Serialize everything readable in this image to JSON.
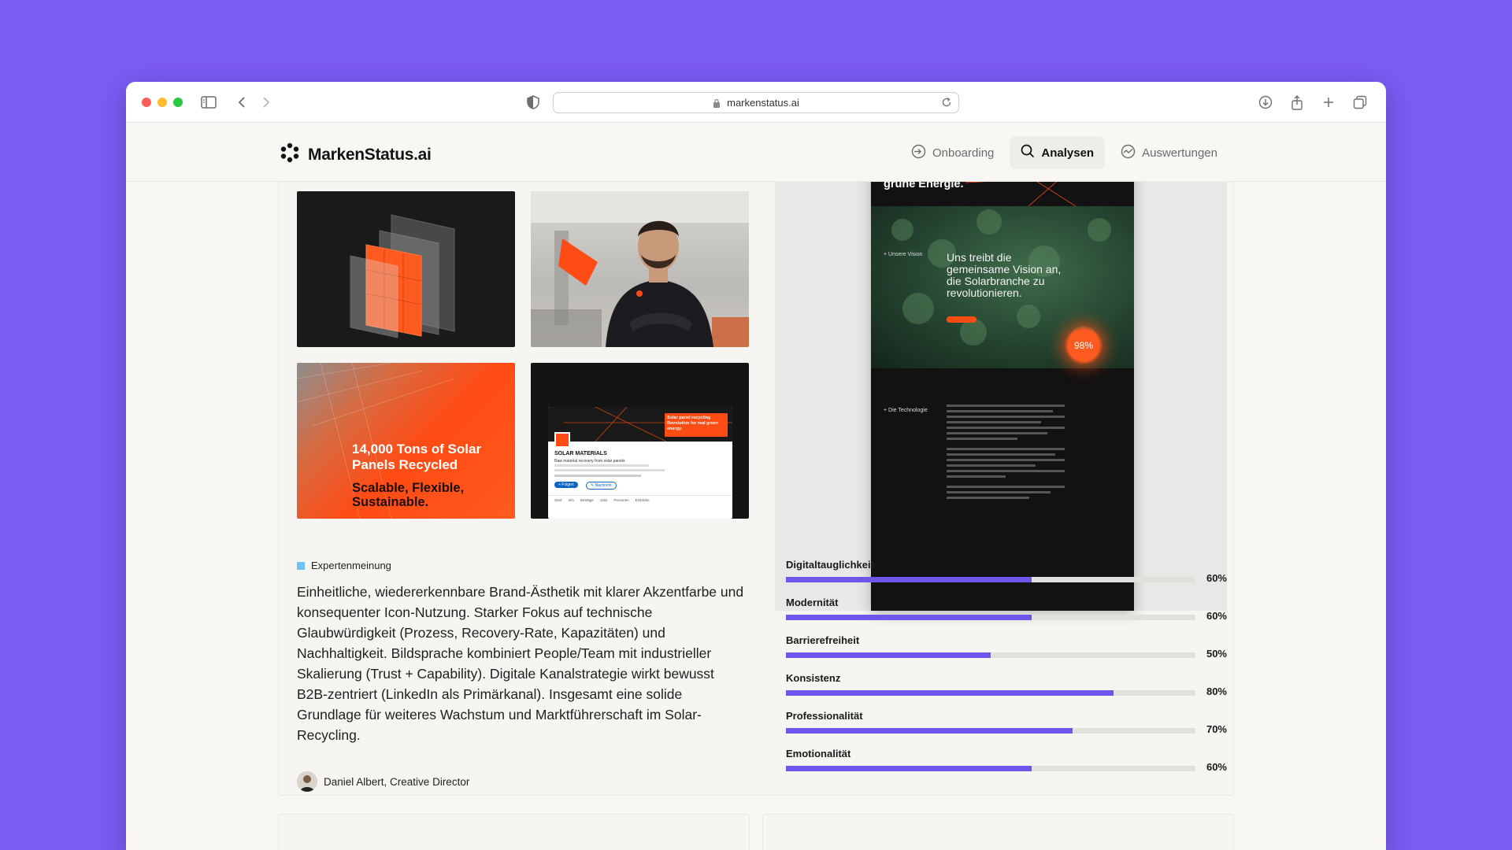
{
  "browser": {
    "url": "markenstatus.ai"
  },
  "app": {
    "brand": "MarkenStatus.ai",
    "nav": [
      {
        "label": "Onboarding",
        "icon": "login-arrow-icon",
        "active": false
      },
      {
        "label": "Analysen",
        "icon": "search-icon",
        "active": true
      },
      {
        "label": "Auswertungen",
        "icon": "trend-icon",
        "active": false
      }
    ]
  },
  "gallery": {
    "recycled_title": "14,000 Tons of Solar Panels Recycled",
    "recycled_sub": "Scalable, Flexible, Sustainable.",
    "linkedin_company": "SOLAR MATERIALS",
    "linkedin_tagline": "Raw material recovery from solar panels",
    "linkedin_banner": "Solar panel recycling Revolution for real green energy.",
    "linkedin_follow": "+ Folgen",
    "linkedin_message": "✎ Nachricht",
    "linkedin_tabs": [
      "Start",
      "Info",
      "Beiträge",
      "Jobs",
      "Personen",
      "Einblicke"
    ]
  },
  "preview": {
    "hero_text": "Solar panel Recycling Revolution für wirklich grüne Energie.",
    "vision_label": "+ Unsere Vision",
    "vision_title": "Uns treibt die gemeinsame Vision an, die Solarbranche zu revolutionieren.",
    "badge": "98%",
    "tech_label": "+ Die Technologie"
  },
  "expert": {
    "tag": "Expertenmeinung",
    "text": "Einheitliche, wiedererkennbare Brand-Ästhetik mit klarer Akzentfarbe und konsequenter Icon-Nutzung. Starker Fokus auf technische Glaubwürdigkeit (Prozess, Recovery-Rate, Kapazitäten) und Nachhaltigkeit. Bildsprache kombiniert People/Team mit industrieller Skalierung (Trust + Capability). Digitale Kanalstrategie wirkt bewusst B2B-zentriert (LinkedIn als Primärkanal). Insgesamt eine solide Grundlage für weiteres Wachstum und Marktführerschaft im Solar-Recycling.",
    "author": "Daniel Albert, Creative Director"
  },
  "metrics": [
    {
      "label": "Digitaltauglichkeit",
      "value": 60,
      "display": "60%"
    },
    {
      "label": "Modernität",
      "value": 60,
      "display": "60%"
    },
    {
      "label": "Barrierefreiheit",
      "value": 50,
      "display": "50%"
    },
    {
      "label": "Konsistenz",
      "value": 80,
      "display": "80%"
    },
    {
      "label": "Professionalität",
      "value": 70,
      "display": "70%"
    },
    {
      "label": "Emotionalität",
      "value": 60,
      "display": "60%"
    }
  ],
  "colors": {
    "accent": "#6f56ea",
    "brand_orange": "#ff4b14",
    "tag": "#6fc3f7"
  }
}
